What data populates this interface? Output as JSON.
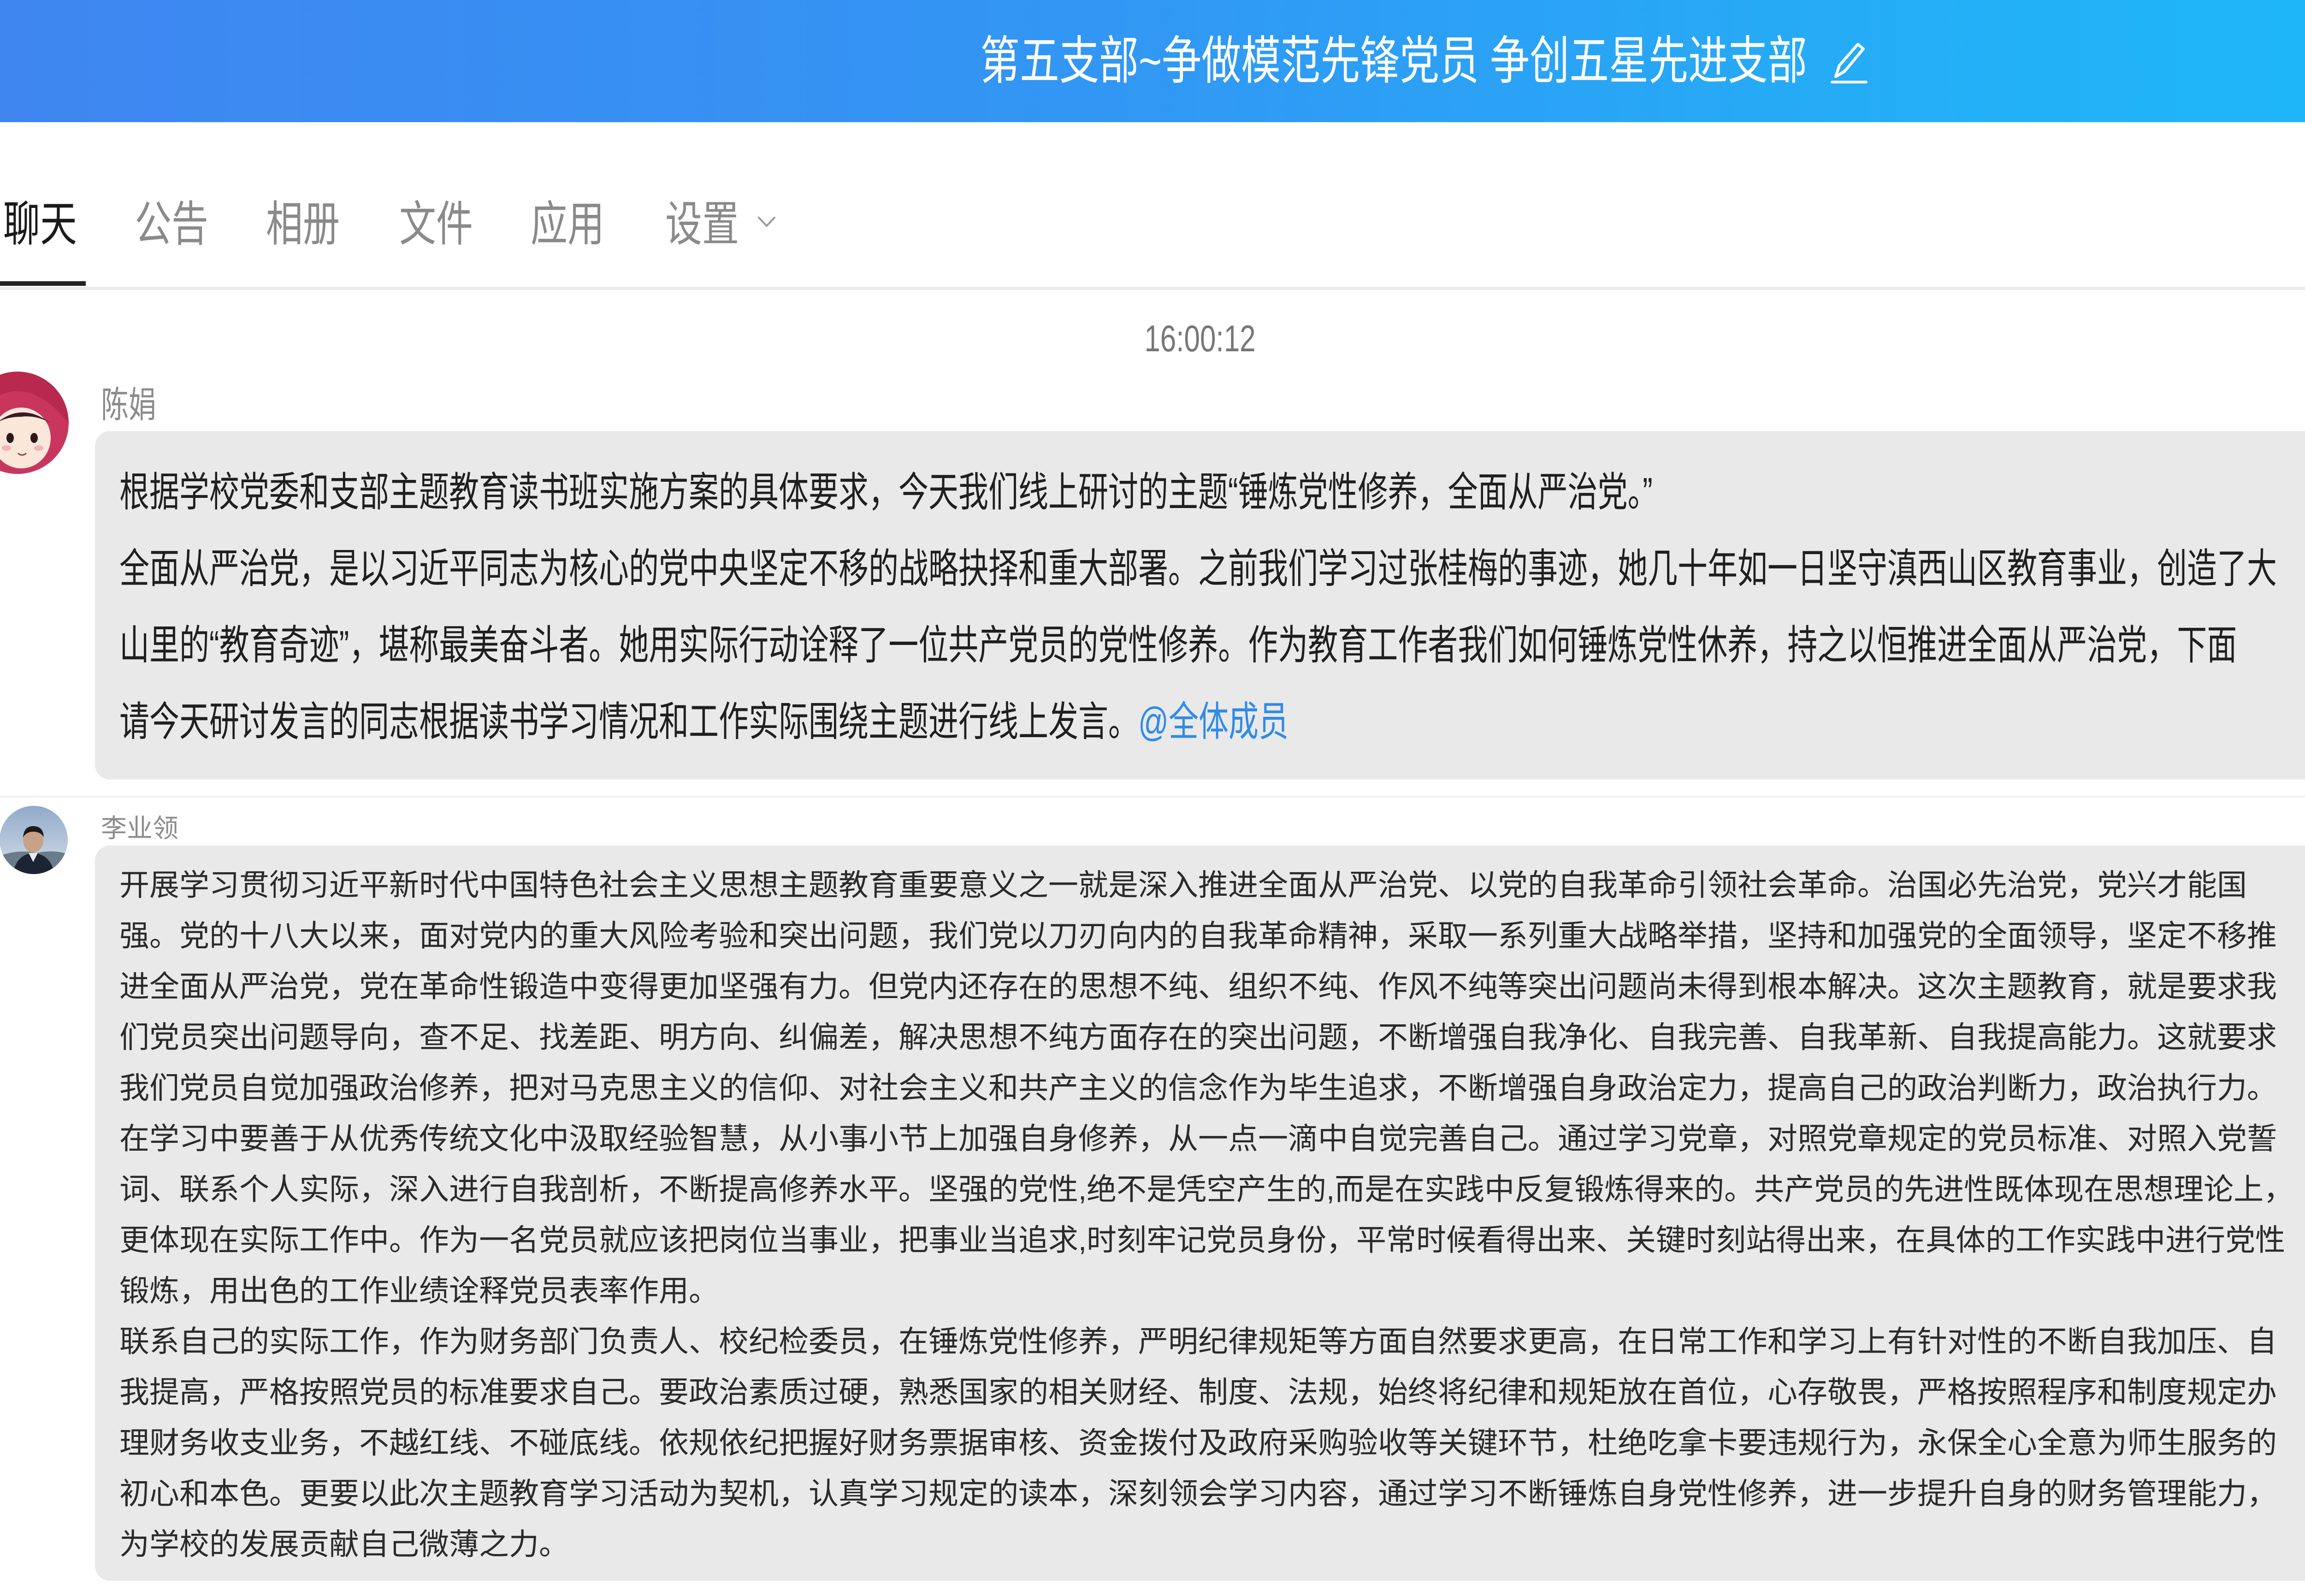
{
  "header": {
    "title": "第五支部~争做模范先锋党员 争创五星先进支部",
    "edit_icon": "pencil-icon"
  },
  "tabs": [
    {
      "label": "聊天",
      "active": true
    },
    {
      "label": "公告",
      "active": false
    },
    {
      "label": "相册",
      "active": false
    },
    {
      "label": "文件",
      "active": false
    },
    {
      "label": "应用",
      "active": false
    },
    {
      "label": "设置",
      "active": false,
      "dropdown_icon": "chevron-down-icon"
    }
  ],
  "chat": {
    "timestamp": "16:00:12",
    "messages": [
      {
        "sender": "陈娟",
        "avatar": "cartoon-girl-avatar",
        "lines": [
          "根据学校党委和支部主题教育读书班实施方案的具体要求，今天我们线上研讨的主题“锤炼党性修养，全面从严治党。”",
          "全面从严治党，是以习近平同志为核心的党中央坚定不移的战略抉择和重大部署。之前我们学习过张桂梅的事迹，她几十年如一日坚守滇西山区教育事业，创造了大",
          "山里的“教育奇迹”，堪称最美奋斗者。她用实际行动诠释了一位共产党员的党性修养。作为教育工作者我们如何锤炼党性休养，持之以恒推进全面从严治党，下面",
          "请今天研讨发言的同志根据读书学习情况和工作实际围绕主题进行线上发言。"
        ],
        "mention": "@全体成员"
      },
      {
        "sender": "李业领",
        "avatar": "man-photo-avatar",
        "lines": [
          "开展学习贯彻习近平新时代中国特色社会主义思想主题教育重要意义之一就是深入推进全面从严治党、以党的自我革命引领社会革命。治国必先治党，党兴才能国",
          "强。党的十八大以来，面对党内的重大风险考验和突出问题，我们党以刀刃向内的自我革命精神，采取一系列重大战略举措，坚持和加强党的全面领导，坚定不移推",
          "进全面从严治党，党在革命性锻造中变得更加坚强有力。但党内还存在的思想不纯、组织不纯、作风不纯等突出问题尚未得到根本解决。这次主题教育，就是要求我",
          "们党员突出问题导向，查不足、找差距、明方向、纠偏差，解决思想不纯方面存在的突出问题，不断增强自我净化、自我完善、自我革新、自我提高能力。这就要求",
          "我们党员自觉加强政治修养，把对马克思主义的信仰、对社会主义和共产主义的信念作为毕生追求，不断增强自身政治定力，提高自己的政治判断力，政治执行力。",
          "在学习中要善于从优秀传统文化中汲取经验智慧，从小事小节上加强自身修养，从一点一滴中自觉完善自己。通过学习党章，对照党章规定的党员标准、对照入党誓",
          "词、联系个人实际，深入进行自我剖析，不断提高修养水平。坚强的党性,绝不是凭空产生的,而是在实践中反复锻炼得来的。共产党员的先进性既体现在思想理论上，",
          "更体现在实际工作中。作为一名党员就应该把岗位当事业，把事业当追求,时刻牢记党员身份，平常时候看得出来、关键时刻站得出来，在具体的工作实践中进行党性",
          "锻炼，用出色的工作业绩诠释党员表率作用。",
          "联系自己的实际工作，作为财务部门负责人、校纪检委员，在锤炼党性修养，严明纪律规矩等方面自然要求更高，在日常工作和学习上有针对性的不断自我加压、自",
          "我提高，严格按照党员的标准要求自己。要政治素质过硬，熟悉国家的相关财经、制度、法规，始终将纪律和规矩放在首位，心存敬畏，严格按照程序和制度规定办",
          "理财务收支业务，不越红线、不碰底线。依规依纪把握好财务票据审核、资金拨付及政府采购验收等关键环节，杜绝吃拿卡要违规行为，永保全心全意为师生服务的",
          "初心和本色。更要以此次主题教育学习活动为契机，认真学习规定的读本，深刻领会学习内容，通过学习不断锤炼自身党性修养，进一步提升自身的财务管理能力，",
          "为学校的发展贡献自己微薄之力。"
        ]
      }
    ]
  },
  "colors": {
    "header_left": "#3f86f1",
    "header_right": "#1db8f8",
    "bubble": "#e9e9e9",
    "mention": "#2f8ae8",
    "active_tab": "#1a1a1a",
    "inactive_tab": "#8a8a8a"
  }
}
